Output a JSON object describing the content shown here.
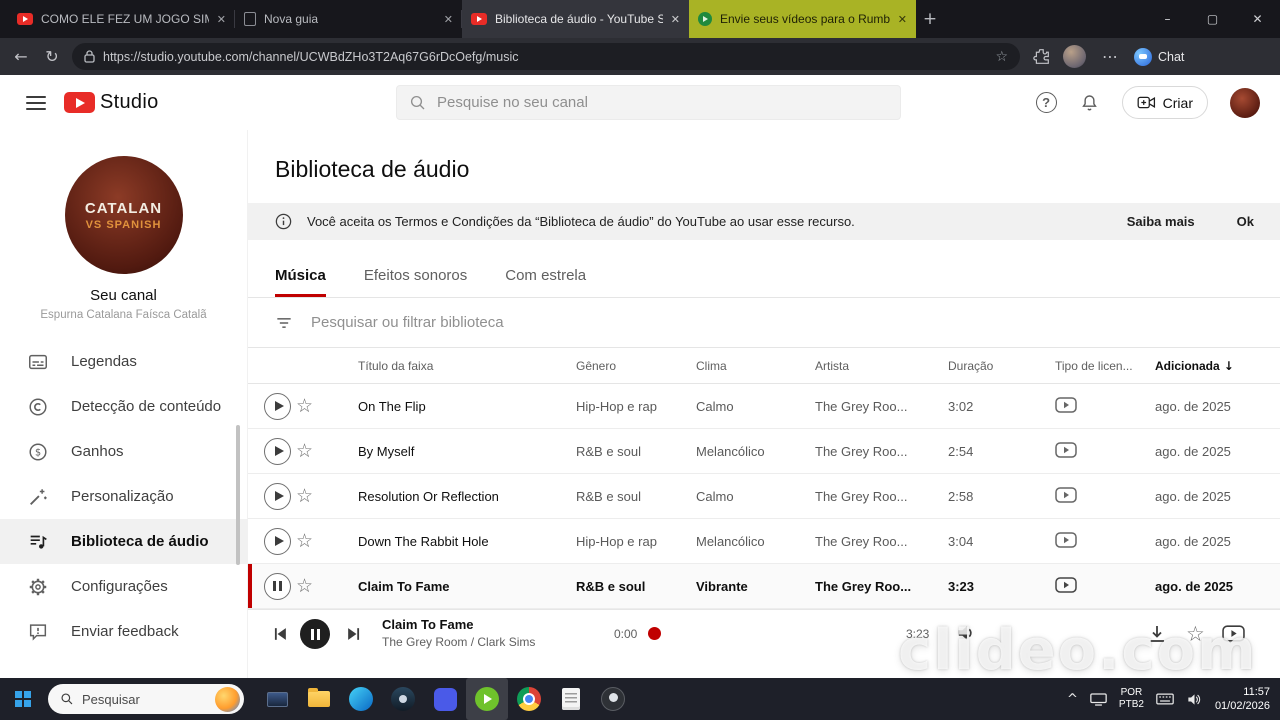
{
  "browser": {
    "tabs": [
      {
        "title": "COMO ELE FEZ UM JOGO SIMPLE",
        "icon": "youtube"
      },
      {
        "title": "Nova guia",
        "icon": "page"
      },
      {
        "title": "Biblioteca de áudio - YouTube Stu",
        "icon": "youtube"
      },
      {
        "title": "Envie seus vídeos para o Rumble",
        "icon": "rumble"
      }
    ],
    "url": "https://studio.youtube.com/channel/UCWBdZHo3T2Aq67G6rDcOefg/music",
    "chat_label": "Chat"
  },
  "studio_header": {
    "logo_text": "Studio",
    "search_placeholder": "Pesquise no seu canal",
    "create_label": "Criar"
  },
  "sidebar": {
    "avatar_line1": "CATALAN",
    "avatar_line2": "VS SPANISH",
    "channel_name": "Seu canal",
    "channel_subtitle": "Espurna Catalana Faísca Catalã",
    "items": [
      {
        "label": "Legendas"
      },
      {
        "label": "Detecção de conteúdo"
      },
      {
        "label": "Ganhos"
      },
      {
        "label": "Personalização"
      },
      {
        "label": "Biblioteca de áudio"
      },
      {
        "label": "Configurações"
      },
      {
        "label": "Enviar feedback"
      }
    ]
  },
  "main": {
    "title": "Biblioteca de áudio",
    "banner": {
      "text": "Você aceita os Termos e Condições da “Biblioteca de áudio” do YouTube ao usar esse recurso.",
      "learn_more": "Saiba mais",
      "ok": "Ok"
    },
    "tabs": [
      "Música",
      "Efeitos sonoros",
      "Com estrela"
    ],
    "filter_placeholder": "Pesquisar ou filtrar biblioteca",
    "table": {
      "headers": [
        "Título da faixa",
        "Gênero",
        "Clima",
        "Artista",
        "Duração",
        "Tipo de licen...",
        "Adicionada"
      ],
      "rows": [
        {
          "title": "On The Flip",
          "genre": "Hip-Hop e rap",
          "mood": "Calmo",
          "artist": "The Grey Roo...",
          "duration": "3:02",
          "added": "ago. de 2025"
        },
        {
          "title": "By Myself",
          "genre": "R&B e soul",
          "mood": "Melancólico",
          "artist": "The Grey Roo...",
          "duration": "2:54",
          "added": "ago. de 2025"
        },
        {
          "title": "Resolution Or Reflection",
          "genre": "R&B e soul",
          "mood": "Calmo",
          "artist": "The Grey Roo...",
          "duration": "2:58",
          "added": "ago. de 2025"
        },
        {
          "title": "Down The Rabbit Hole",
          "genre": "Hip-Hop e rap",
          "mood": "Melancólico",
          "artist": "The Grey Roo...",
          "duration": "3:04",
          "added": "ago. de 2025"
        },
        {
          "title": "Claim To Fame",
          "genre": "R&B e soul",
          "mood": "Vibrante",
          "artist": "The Grey Roo...",
          "duration": "3:23",
          "added": "ago. de 2025"
        }
      ]
    }
  },
  "player": {
    "track_title": "Claim To Fame",
    "track_artist": "The Grey Room / Clark Sims",
    "current_time": "0:00",
    "total_time": "3:23"
  },
  "watermark": "clideo.com",
  "taskbar": {
    "search_placeholder": "Pesquisar",
    "language_line1": "POR",
    "language_line2": "PTB2",
    "time": "11:57",
    "date": "01/02/2026"
  }
}
